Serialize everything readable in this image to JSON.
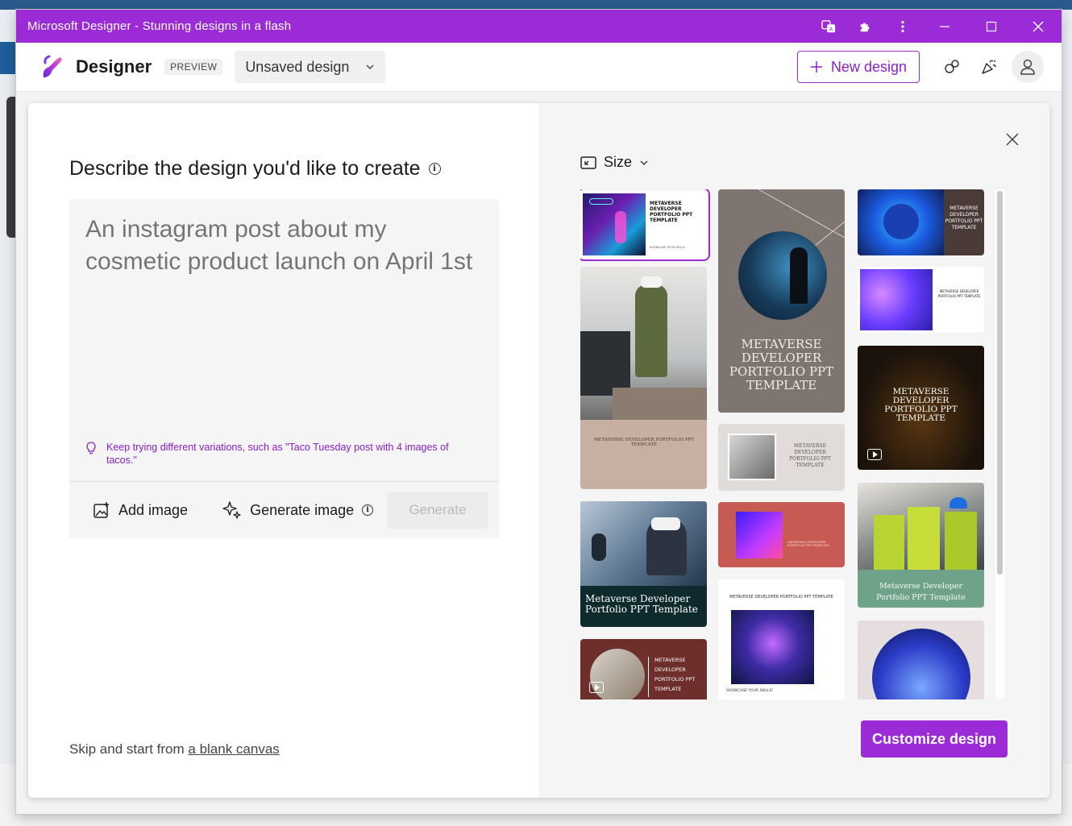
{
  "window": {
    "title": "Microsoft Designer - Stunning designs in a flash"
  },
  "appbar": {
    "brand": "Designer",
    "badge": "PREVIEW",
    "design_name": "Unsaved design",
    "new_design_label": "New design"
  },
  "dialog": {
    "heading": "Describe the design you'd like to create",
    "prompt_placeholder": "An instagram post about my cosmetic product launch on April 1st",
    "tip": "Keep trying different variations, such as \"Taco Tuesday post with 4 images of tacos.\"",
    "add_image_label": "Add image",
    "generate_image_label": "Generate image",
    "generate_label": "Generate",
    "skip_prefix": "Skip and start from ",
    "skip_link": "a blank canvas",
    "size_label": "Size",
    "customize_label": "Customize design"
  },
  "templates": {
    "c1_t1": "METAVERSE DEVELOPER PORTFOLIO PPT TEMPLATE",
    "c1_t1_sub": "SHOWCASE YOUR SKILLS",
    "c1_t2": "METAVERSE DEVELOPER PORTFOLIO PPT TEMPLATE",
    "c1_t3": "Metaverse Developer Portfolio PPT Template",
    "c1_t4": "METAVERSE DEVELOPER PORTFOLIO PPT TEMPLATE",
    "c2_t1": "METAVERSE DEVELOPER PORTFOLIO PPT TEMPLATE",
    "c2_t2": "METAVERSE DEVELOPER PORTFOLIO PPT TEMPLATE",
    "c2_t3": "METAVERSE DEVELOPER PORTFOLIO PPT TEMPLATE",
    "c2_t4": "METAVERSE DEVELOPER PORTFOLIO PPT TEMPLATE",
    "c2_t4_sub": "SHOWCASE YOUR SKILLS!",
    "c3_t1": "METAVERSE DEVELOPER PORTFOLIO PPT TEMPLATE",
    "c3_t2": "METAVERSE DEVELOPER PORTFOLIO PPT TEMPLATE",
    "c3_t3": "METAVERSE DEVELOPER PORTFOLIO PPT TEMPLATE",
    "c3_t4": "Metaverse Developer Portfolio PPT Template"
  },
  "colors": {
    "accent": "#9b2bd6",
    "titlebar": "#9b2bd6"
  },
  "icons": [
    "translate-icon",
    "extensions-icon",
    "more-icon",
    "minimize-icon",
    "maximize-icon",
    "close-icon",
    "plus-icon",
    "share-icon",
    "celebrate-icon",
    "avatar-icon",
    "info-icon",
    "lightbulb-icon",
    "add-image-icon",
    "sparkle-icon",
    "resize-icon",
    "chevron-down-icon",
    "play-icon"
  ]
}
